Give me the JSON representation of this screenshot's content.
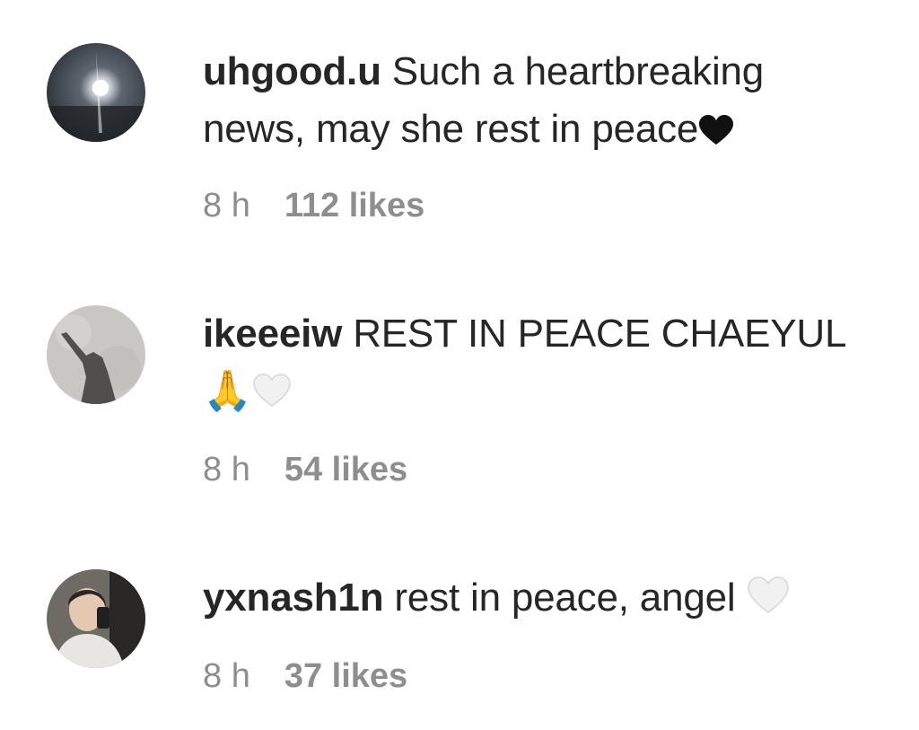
{
  "comments": [
    {
      "username": "uhgood.u",
      "text_line1": "Such a heartbreaking",
      "text_line2": "news, may she rest in peace",
      "emoji": "black-heart-icon",
      "time": "8 h",
      "likes": "112 likes",
      "avatar": "night-sky-light-avatar"
    },
    {
      "username": "ikeeeiw",
      "text_line1": "REST IN PEACE CHAEYUL",
      "text_line2": "🙏",
      "emoji": "white-heart-icon",
      "time": "8 h",
      "likes": "54 likes",
      "avatar": "shadow-silhouette-avatar"
    },
    {
      "username": "yxnash1n",
      "text_line1": "rest in peace, angel",
      "emoji": "white-heart-icon",
      "time": "8 h",
      "likes": "37 likes",
      "avatar": "mirror-selfie-avatar"
    }
  ],
  "colors": {
    "text": "#262626",
    "meta": "#8e8e8e",
    "background": "#ffffff"
  }
}
